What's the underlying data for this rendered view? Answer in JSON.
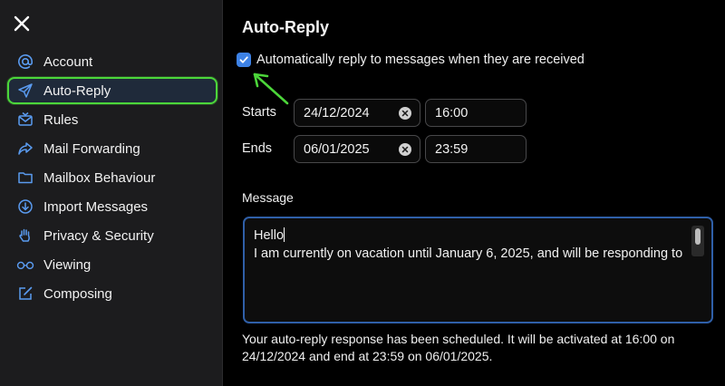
{
  "sidebar": {
    "items": [
      {
        "label": "Account",
        "icon": "at-icon"
      },
      {
        "label": "Auto-Reply",
        "icon": "paper-plane-icon",
        "active": true
      },
      {
        "label": "Rules",
        "icon": "envelope-rules-icon"
      },
      {
        "label": "Mail Forwarding",
        "icon": "forward-arrow-icon"
      },
      {
        "label": "Mailbox Behaviour",
        "icon": "folder-icon"
      },
      {
        "label": "Import Messages",
        "icon": "download-circle-icon"
      },
      {
        "label": "Privacy & Security",
        "icon": "hand-icon"
      },
      {
        "label": "Viewing",
        "icon": "glasses-icon"
      },
      {
        "label": "Composing",
        "icon": "compose-icon"
      }
    ]
  },
  "main": {
    "title": "Auto-Reply",
    "auto_reply_checkbox": {
      "label": "Automatically reply to messages when they are received",
      "checked": true
    },
    "starts": {
      "label": "Starts",
      "date": "24/12/2024",
      "time": "16:00"
    },
    "ends": {
      "label": "Ends",
      "date": "06/01/2025",
      "time": "23:59"
    },
    "message": {
      "label": "Message",
      "line1": "Hello",
      "line2": "I am currently on vacation until January 6, 2025, and will be responding to"
    },
    "status_text": "Your auto-reply response has been scheduled. It will be activated at 16:00 on 24/12/2024 and end at 23:59 on 06/01/2025."
  },
  "colors": {
    "accent": "#3d82e6",
    "icon_blue": "#5a9bf0",
    "highlight_green": "#4cd63a",
    "sidebar_bg": "#1c1c1e",
    "main_bg": "#000000"
  }
}
